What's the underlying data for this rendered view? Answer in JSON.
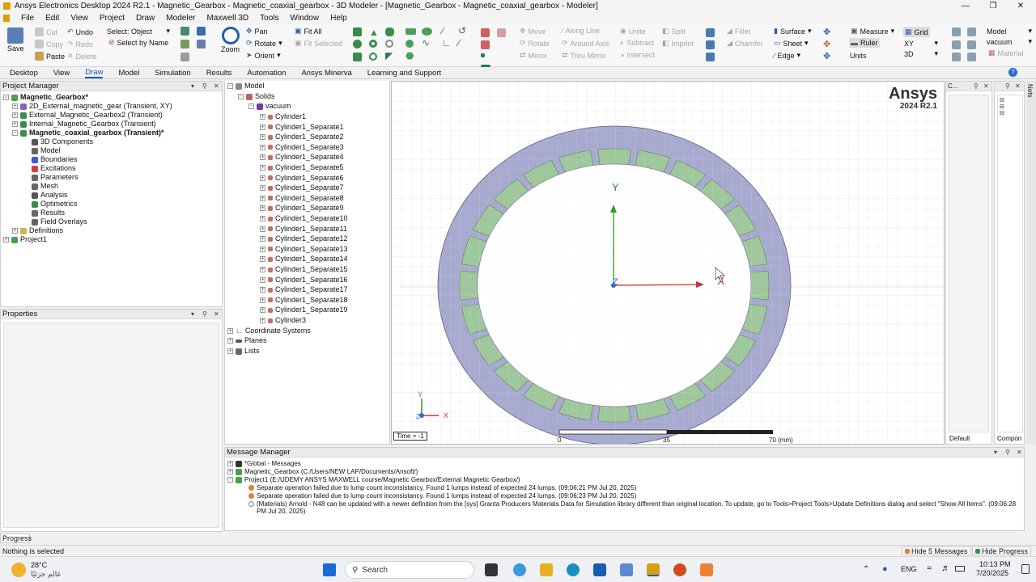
{
  "window": {
    "title": "Ansys Electronics Desktop 2024 R2.1 - Magnetic_Gearbox - Magnetic_coaxial_gearbox - 3D Modeler - [Magnetic_Gearbox - Magnetic_coaxial_gearbox - Modeler]"
  },
  "menu": [
    "File",
    "Edit",
    "View",
    "Project",
    "Draw",
    "Modeler",
    "Maxwell 3D",
    "Tools",
    "Window",
    "Help"
  ],
  "ribbon": {
    "save": "Save",
    "cut": "Cut",
    "copy": "Copy",
    "paste": "Paste",
    "undo": "Undo",
    "redo": "Redo",
    "delete": "Delete",
    "select": "Select: Object",
    "select_by_name": "Select by Name",
    "zoom": "Zoom",
    "pan": "Pan",
    "rotate": "Rotate",
    "orient": "Orient",
    "fit_all": "Fit All",
    "fit_selected": "Fit Selected",
    "move": "Move",
    "rotate2": "Rotate",
    "mirror": "Mirror",
    "along_line": "Along Line",
    "around_axis": "Around Axis",
    "thru_mirror": "Thru Mirror",
    "unite": "Unite",
    "subtract": "Subtract",
    "intersect": "Intersect",
    "split": "Split",
    "imprint": "Imprint",
    "fillet": "Fillet",
    "chamfer": "Chamfer",
    "surface": "Surface",
    "sheet": "Sheet",
    "edge": "Edge",
    "measure": "Measure",
    "ruler": "Ruler",
    "units": "Units",
    "grid": "Grid",
    "plane": "XY",
    "dim": "3D",
    "model": "Model",
    "material_val": "vacuum",
    "material": "Material"
  },
  "tabs": [
    "Desktop",
    "View",
    "Draw",
    "Model",
    "Simulation",
    "Results",
    "Automation",
    "Ansys Minerva",
    "Learning and Support"
  ],
  "active_tab": "Draw",
  "project_manager": {
    "title": "Project Manager",
    "items": [
      "Magnetic_Gearbox*",
      "2D_External_magnetic_gear (Transient, XY)",
      "External_Magnetic_Gearbox2 (Transient)",
      "Internal_Magnetic_Gearbox (Transient)",
      "Magnetic_coaxial_gearbox (Transient)*",
      "3D Components",
      "Model",
      "Boundaries",
      "Excitations",
      "Parameters",
      "Mesh",
      "Analysis",
      "Optimetrics",
      "Results",
      "Field Overlays",
      "Definitions",
      "Project1"
    ]
  },
  "properties": {
    "title": "Properties"
  },
  "model_tree": {
    "items": [
      "Model",
      "Solids",
      "vacuum",
      "Cylinder1",
      "Cylinder1_Separate1",
      "Cylinder1_Separate2",
      "Cylinder1_Separate3",
      "Cylinder1_Separate4",
      "Cylinder1_Separate5",
      "Cylinder1_Separate6",
      "Cylinder1_Separate7",
      "Cylinder1_Separate8",
      "Cylinder1_Separate9",
      "Cylinder1_Separate10",
      "Cylinder1_Separate11",
      "Cylinder1_Separate12",
      "Cylinder1_Separate13",
      "Cylinder1_Separate14",
      "Cylinder1_Separate15",
      "Cylinder1_Separate16",
      "Cylinder1_Separate17",
      "Cylinder1_Separate18",
      "Cylinder1_Separate19",
      "Cylinder3",
      "Coordinate Systems",
      "Planes",
      "Lists"
    ]
  },
  "viewport": {
    "brand": "Ansys",
    "version": "2024 R2.1",
    "time": "Time = -1",
    "scale_labels": [
      "0",
      "35",
      "70 (mm)"
    ],
    "axis_x": "X",
    "axis_y": "Y",
    "axis_z": "Z",
    "segments": 24
  },
  "side_panel": {
    "default": "Default",
    "component": "Compon",
    "nets": "Nets"
  },
  "message_manager": {
    "title": "Message Manager",
    "items": [
      "*Global - Messages",
      "Magnetic_Gearbox (C:/Users/NEW LAP/Documents/Ansoft/)",
      "Project1 (E:/UDEMY ANSYS MAXWELL course/Magnetic Gearbox/External Magnetic Gearbox/)",
      "Separate operation failed due to lump count inconsistancy. Found 1 lumps instead of expected 24 lumps. (09:06:21 PM  Jul 20, 2025)",
      "Separate operation failed due to lump count inconsistancy. Found 1 lumps instead of expected 24 lumps. (09:06:23 PM  Jul 20, 2025)",
      "(Materials) Arnold - N48 can be updated with a newer definition from the [sys] Granta Producers Materials Data for Simulation library different than original location. To update, go to Tools>Project Tools>Update Definitions dialog and select \"Show All Items\". (09:06:28",
      "PM  Jul 20, 2025)"
    ]
  },
  "progress": "Progress",
  "status": {
    "text": "Nothing is selected",
    "hide_messages": "Hide 5 Messages",
    "hide_progress": "Hide Progress"
  },
  "taskbar": {
    "temp": "28°C",
    "weather": "عالم جزئيًا",
    "search": "Search",
    "lang": "ENG",
    "time": "10:13 PM",
    "date": "7/20/2025"
  }
}
